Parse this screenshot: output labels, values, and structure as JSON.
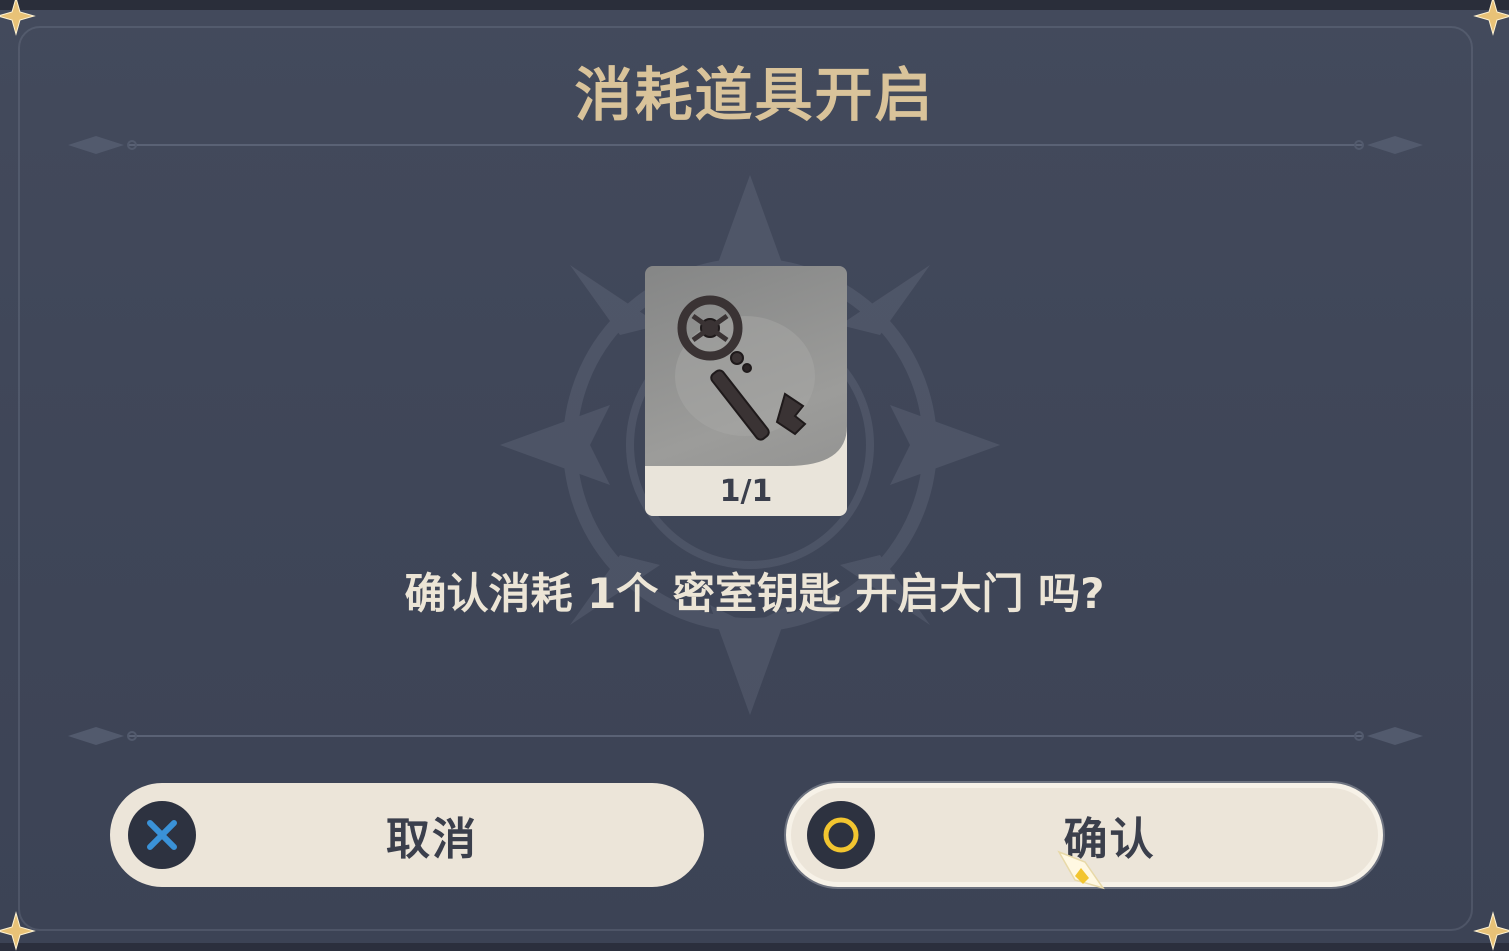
{
  "dialog": {
    "title": "消耗道具开启",
    "prompt": "确认消耗 1个 密室钥匙 开启大门 吗?"
  },
  "item": {
    "icon": "key-icon",
    "count": "1/1"
  },
  "buttons": {
    "cancel": {
      "label": "取消",
      "icon": "cross-icon",
      "icon_color": "#3a92d8"
    },
    "confirm": {
      "label": "确认",
      "icon": "circle-icon",
      "icon_color": "#f2c530"
    }
  },
  "colors": {
    "panel": "#414859",
    "title": "#d9c39a",
    "text": "#ece5d6",
    "button_bg": "#ece5d9",
    "button_text": "#3b3f4c",
    "corner_gold": "#e8c277"
  }
}
